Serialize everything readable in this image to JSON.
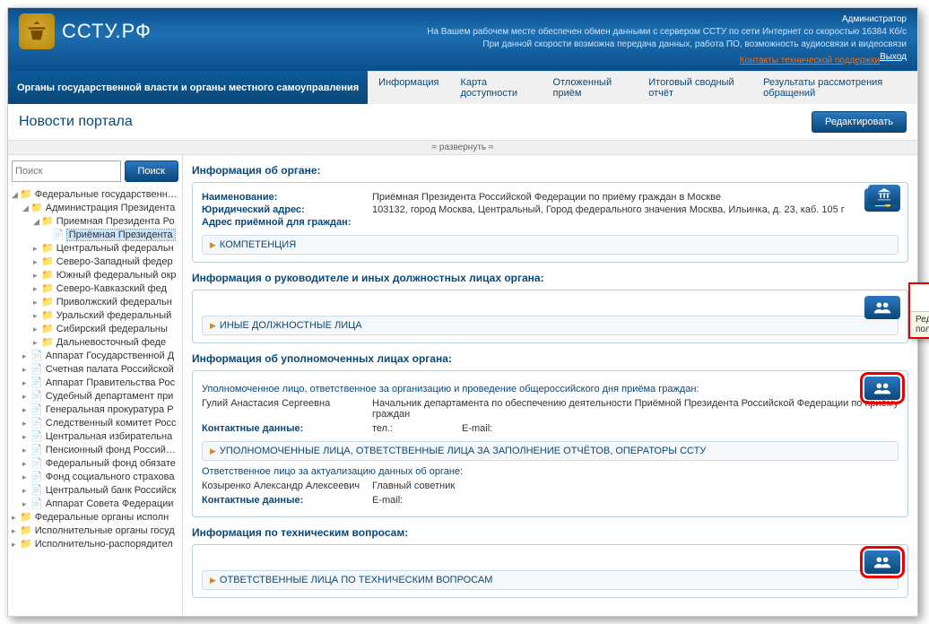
{
  "header": {
    "site_title": "ССТУ.РФ",
    "admin": "Администратор",
    "msg1": "На Вашем рабочем месте обеспечен обмен данными с сервером ССТУ по сети Интернет со скоростью 16384 Кб/с",
    "msg2": "При данной скорости возможна передача данных, работа ПО, возможность аудиосвязи и видеосвязи",
    "support": "Контакты технической поддержки",
    "exit": "Выход"
  },
  "menu": {
    "label": "Органы государственной власти и органы местного самоуправления",
    "items": [
      "Информация",
      "Карта доступности",
      "Отложенный приём",
      "Итоговый сводный отчёт",
      "Результаты рассмотрения обращений"
    ]
  },
  "page_title": "Новости портала",
  "edit_btn": "Редактировать",
  "expand": "≈  развернуть  ≈",
  "search": {
    "placeholder": "Поиск",
    "btn": "Поиск"
  },
  "tree": {
    "root": "Федеральные государственные",
    "admin": "Администрация Президента",
    "priemnaya": "Приемная Президента Ро",
    "selected": "Приёмная Президента",
    "items": [
      "Центральный федеральн",
      "Северо-Западный федер",
      "Южный федеральный окр",
      "Северо-Кавказский фед",
      "Приволжский федеральн",
      "Уральский федеральный",
      "Сибирский федеральны",
      "Дальневосточный феде"
    ],
    "docs": [
      "Аппарат Государственной Д",
      "Счетная палата Российской",
      "Аппарат Правительства Рос",
      "Судебный департамент при",
      "Генеральная прокуратура Р",
      "Следственный комитет Росс",
      "Центральная избирательна",
      "Пенсионный фонд Российско",
      "Федеральный фонд обязате",
      "Фонд социального страхова",
      "Центральный банк Российск",
      "Аппарат Совета Федерации"
    ],
    "bottom": [
      "Федеральные органы исполн",
      "Исполнительные органы госуд",
      "Исполнительно-распорядител"
    ]
  },
  "sections": {
    "s1_title": "Информация об органе:",
    "name_lbl": "Наименование:",
    "name_val": "Приёмная Президента Российской Федерации по приёму граждан в Москве",
    "addr_lbl": "Юридический адрес:",
    "addr_val": "103132, город Москва, Центральный, Город федерального значения Москва, Ильинка, д. 23, каб. 105 г",
    "addr2_lbl": "Адрес приёмной для граждан:",
    "comp": "КОМПЕТЕНЦИЯ",
    "s2_title": "Информация о руководителе и иных должностных лицах органа:",
    "other": "ИНЫЕ ДОЛЖНОСТНЫЕ ЛИЦА",
    "s3_title": "Информация об уполномоченных лицах органа:",
    "auth_title": "Уполномоченное лицо, ответственное за организацию и проведение общероссийского дня приёма граждан:",
    "auth_name": "Гулий Анастасия Сергеевна",
    "auth_pos": "Начальник департамента по обеспечению деятельности Приёмной Президента Российской Федерации по приёму граждан",
    "contact_lbl": "Контактные данные:",
    "tel": "тел.:",
    "email": "E-mail:",
    "ops": "УПОЛНОМОЧЕННЫЕ ЛИЦА, ОТВЕТСТВЕННЫЕ ЛИЦА ЗА ЗАПОЛНЕНИЕ ОТЧЁТОВ, ОПЕРАТОРЫ ССТУ",
    "resp_title": "Ответственное лицо за актуализацию данных об органе:",
    "resp_name": "Козыренко Александр Алексеевич",
    "resp_pos": "Главный советник",
    "s4_title": "Информация по техническим вопросам:",
    "tech": "ОТВЕТСТВЕННЫЕ ЛИЦА ПО ТЕХНИЧЕСКИМ ВОПРОСАМ"
  },
  "tooltip": "Редактировать данные пользователей"
}
